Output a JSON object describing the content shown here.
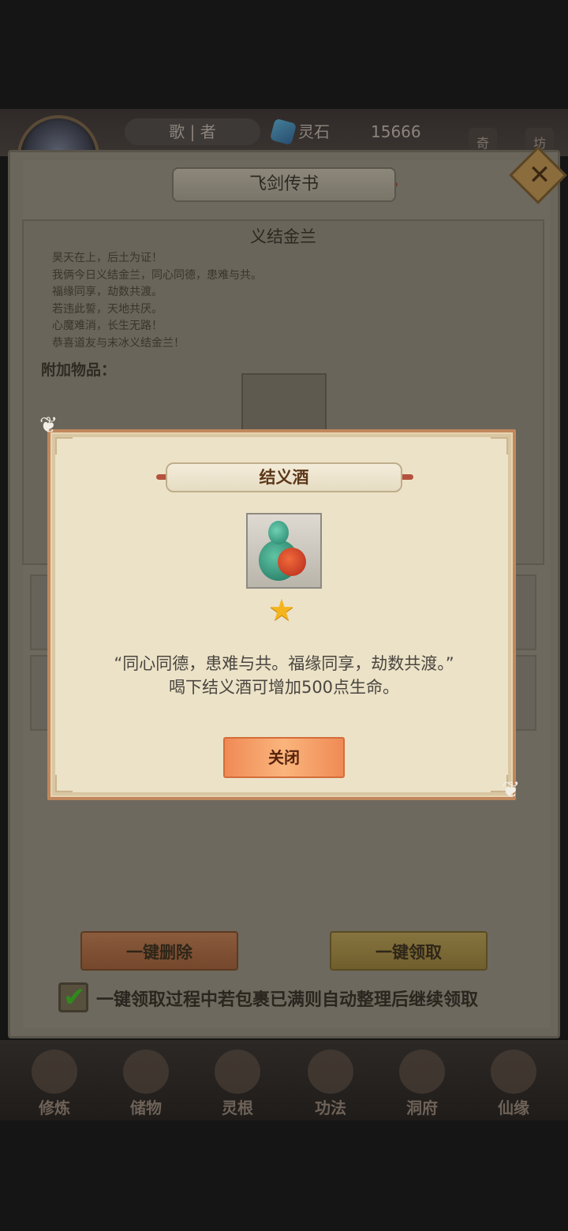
{
  "top_bar": {
    "player_name": "歌 | 者",
    "resource_label": "灵石",
    "resource_value": "15666",
    "side_buttons": [
      "奇",
      "坊"
    ]
  },
  "mail_panel": {
    "title": "飞剑传书",
    "mail_title": "义结金兰",
    "mail_lines": [
      "昊天在上，后土为证！",
      "我俩今日义结金兰，同心同德，患难与共。",
      "福缘同享，劫数共渡。",
      "若违此誓，天地共厌。",
      "心魔难消，长生无路！",
      "恭喜道友与末冰义结金兰！"
    ],
    "attachment_label": "附加物品：",
    "delete_all_label": "一键删除",
    "collect_all_label": "一键领取",
    "auto_sort_checked": true,
    "auto_sort_label": "一键领取过程中若包裹已满则自动整理后继续领取"
  },
  "item_modal": {
    "title": "结义酒",
    "item_icon": "wine-gourd-icon",
    "star_count": 1,
    "quote": "“同心同德，患难与共。福缘同享，劫数共渡。”",
    "effect": "喝下结义酒可增加500点生命。",
    "close_label": "关闭"
  },
  "bottom_nav": {
    "items": [
      "修炼",
      "储物",
      "灵根",
      "功法",
      "洞府",
      "仙缘"
    ]
  },
  "colors": {
    "modal_bg": "#ece2c7",
    "modal_border": "#c0885c",
    "button_orange": "#f08a55",
    "title_brown": "#5d3719",
    "star": "#f5b41c"
  }
}
